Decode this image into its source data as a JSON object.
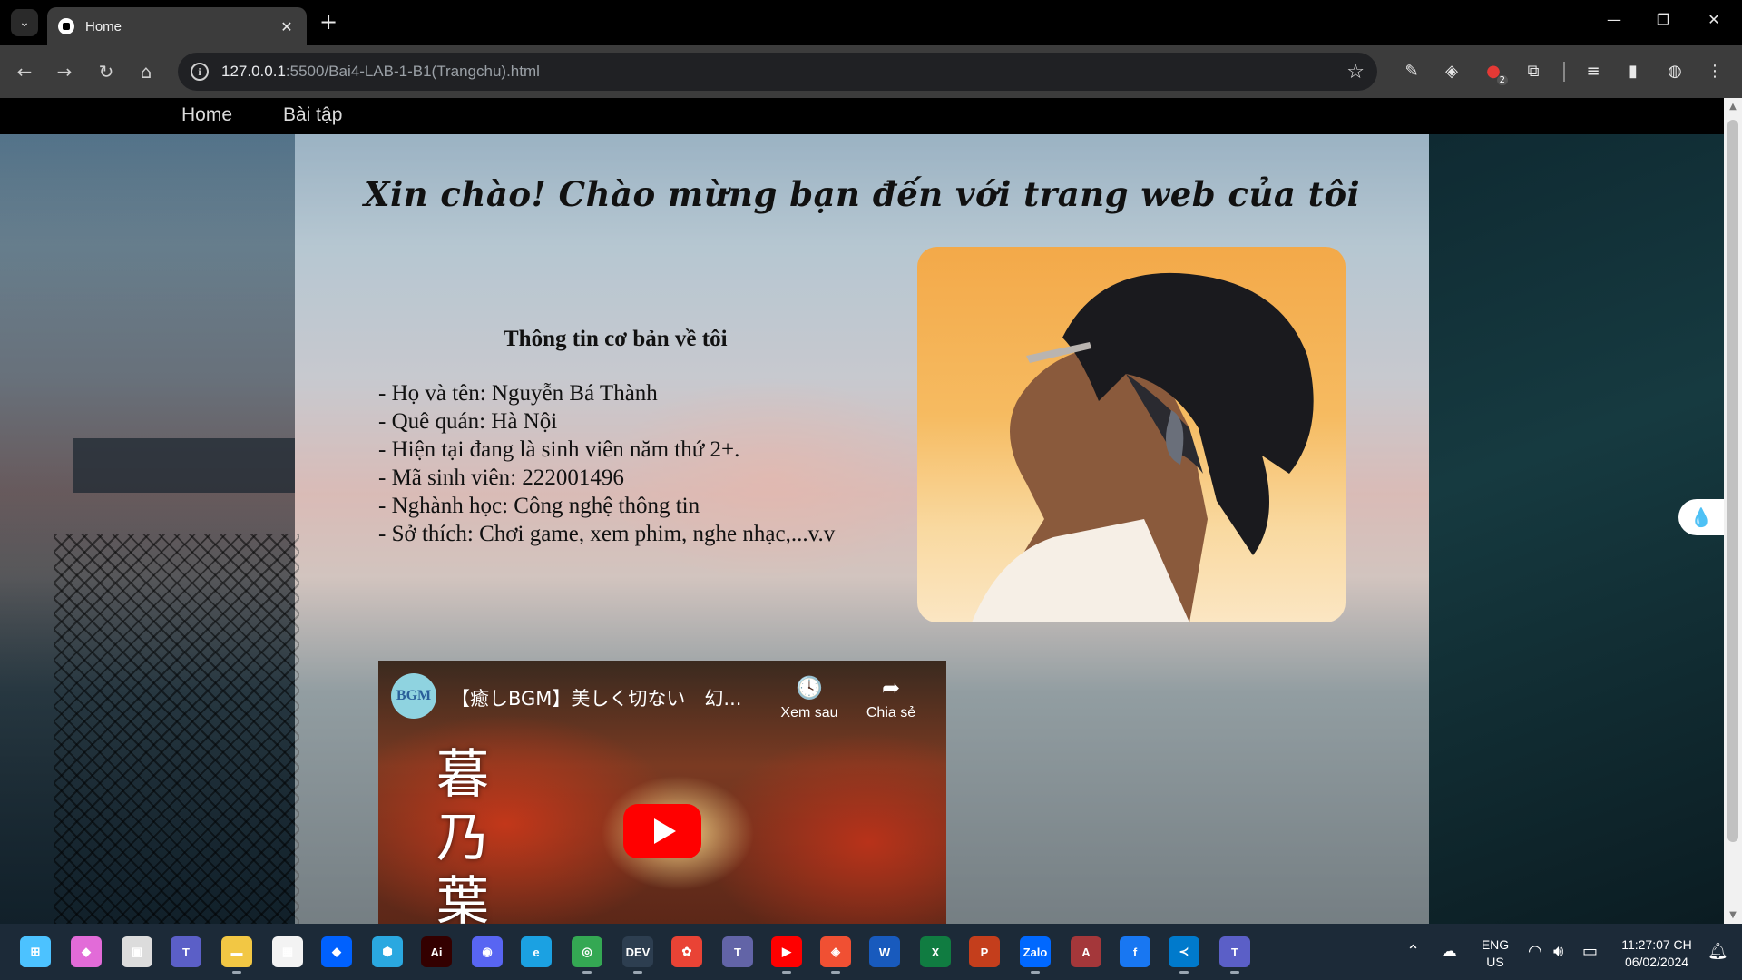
{
  "browser": {
    "tab_title": "Home",
    "url_host": "127.0.0.1",
    "url_rest": ":5500/Bai4-LAB-1-B1(Trangchu).html",
    "extension_badge": "2"
  },
  "site_nav": {
    "items": [
      {
        "label": "Home"
      },
      {
        "label": "Bài tập"
      }
    ]
  },
  "main": {
    "heading": "Xin chào! Chào mừng bạn đến với trang web của tôi",
    "info_title": "Thông tin cơ bản về tôi",
    "info_lines": [
      "- Họ và tên: Nguyễn Bá Thành",
      "- Quê quán: Hà Nội",
      "- Hiện tại đang là sinh viên năm thứ 2+.",
      "- Mã sinh viên: 222001496",
      "- Nghành học: Công nghệ thông tin",
      "- Sở thích: Chơi game, xem phim, nghe nhạc,...v.v"
    ]
  },
  "video": {
    "title": "【癒しBGM】美しく切ない　幻...",
    "channel_logo": "BGM",
    "watch_later": "Xem sau",
    "share": "Chia sẻ",
    "kanji": [
      "暮",
      "乃",
      "葉"
    ]
  },
  "taskbar": {
    "lang_top": "ENG",
    "lang_bottom": "US",
    "time": "11:27:07 CH",
    "date": "06/02/2024",
    "apps": [
      {
        "name": "start",
        "glyph": "⊞",
        "color": "#4cc2ff"
      },
      {
        "name": "copilot",
        "glyph": "◆",
        "color": "#e26bd8"
      },
      {
        "name": "task-view",
        "glyph": "▣",
        "color": "#dcdcdc"
      },
      {
        "name": "teams",
        "glyph": "T",
        "color": "#5b5fc7"
      },
      {
        "name": "file-explorer",
        "glyph": "▬",
        "color": "#f2c744"
      },
      {
        "name": "microsoft-store",
        "glyph": "▦",
        "color": "#f3f3f3"
      },
      {
        "name": "dropbox",
        "glyph": "◆",
        "color": "#0061fe"
      },
      {
        "name": "security",
        "glyph": "⬢",
        "color": "#2aa8e0"
      },
      {
        "name": "illustrator",
        "glyph": "Ai",
        "color": "#330000"
      },
      {
        "name": "discord",
        "glyph": "◉",
        "color": "#5865f2"
      },
      {
        "name": "edge",
        "glyph": "e",
        "color": "#1ba1e2"
      },
      {
        "name": "chrome",
        "glyph": "◎",
        "color": "#34a853"
      },
      {
        "name": "dev-home",
        "glyph": "DEV",
        "color": "#2d3e50"
      },
      {
        "name": "photos",
        "glyph": "✿",
        "color": "#e94335"
      },
      {
        "name": "teams-classic",
        "glyph": "T",
        "color": "#6264a7"
      },
      {
        "name": "youtube",
        "glyph": "▶",
        "color": "#ff0000"
      },
      {
        "name": "git",
        "glyph": "◈",
        "color": "#f05033"
      },
      {
        "name": "word",
        "glyph": "W",
        "color": "#185abd"
      },
      {
        "name": "excel",
        "glyph": "X",
        "color": "#107c41"
      },
      {
        "name": "powerpoint",
        "glyph": "P",
        "color": "#c43e1c"
      },
      {
        "name": "zalo",
        "glyph": "Zalo",
        "color": "#0068ff"
      },
      {
        "name": "access",
        "glyph": "A",
        "color": "#a4373a"
      },
      {
        "name": "facebook",
        "glyph": "f",
        "color": "#1877f2"
      },
      {
        "name": "vscode",
        "glyph": "≺",
        "color": "#007acc"
      },
      {
        "name": "teams-new",
        "glyph": "T",
        "color": "#5b5fc7"
      }
    ]
  }
}
